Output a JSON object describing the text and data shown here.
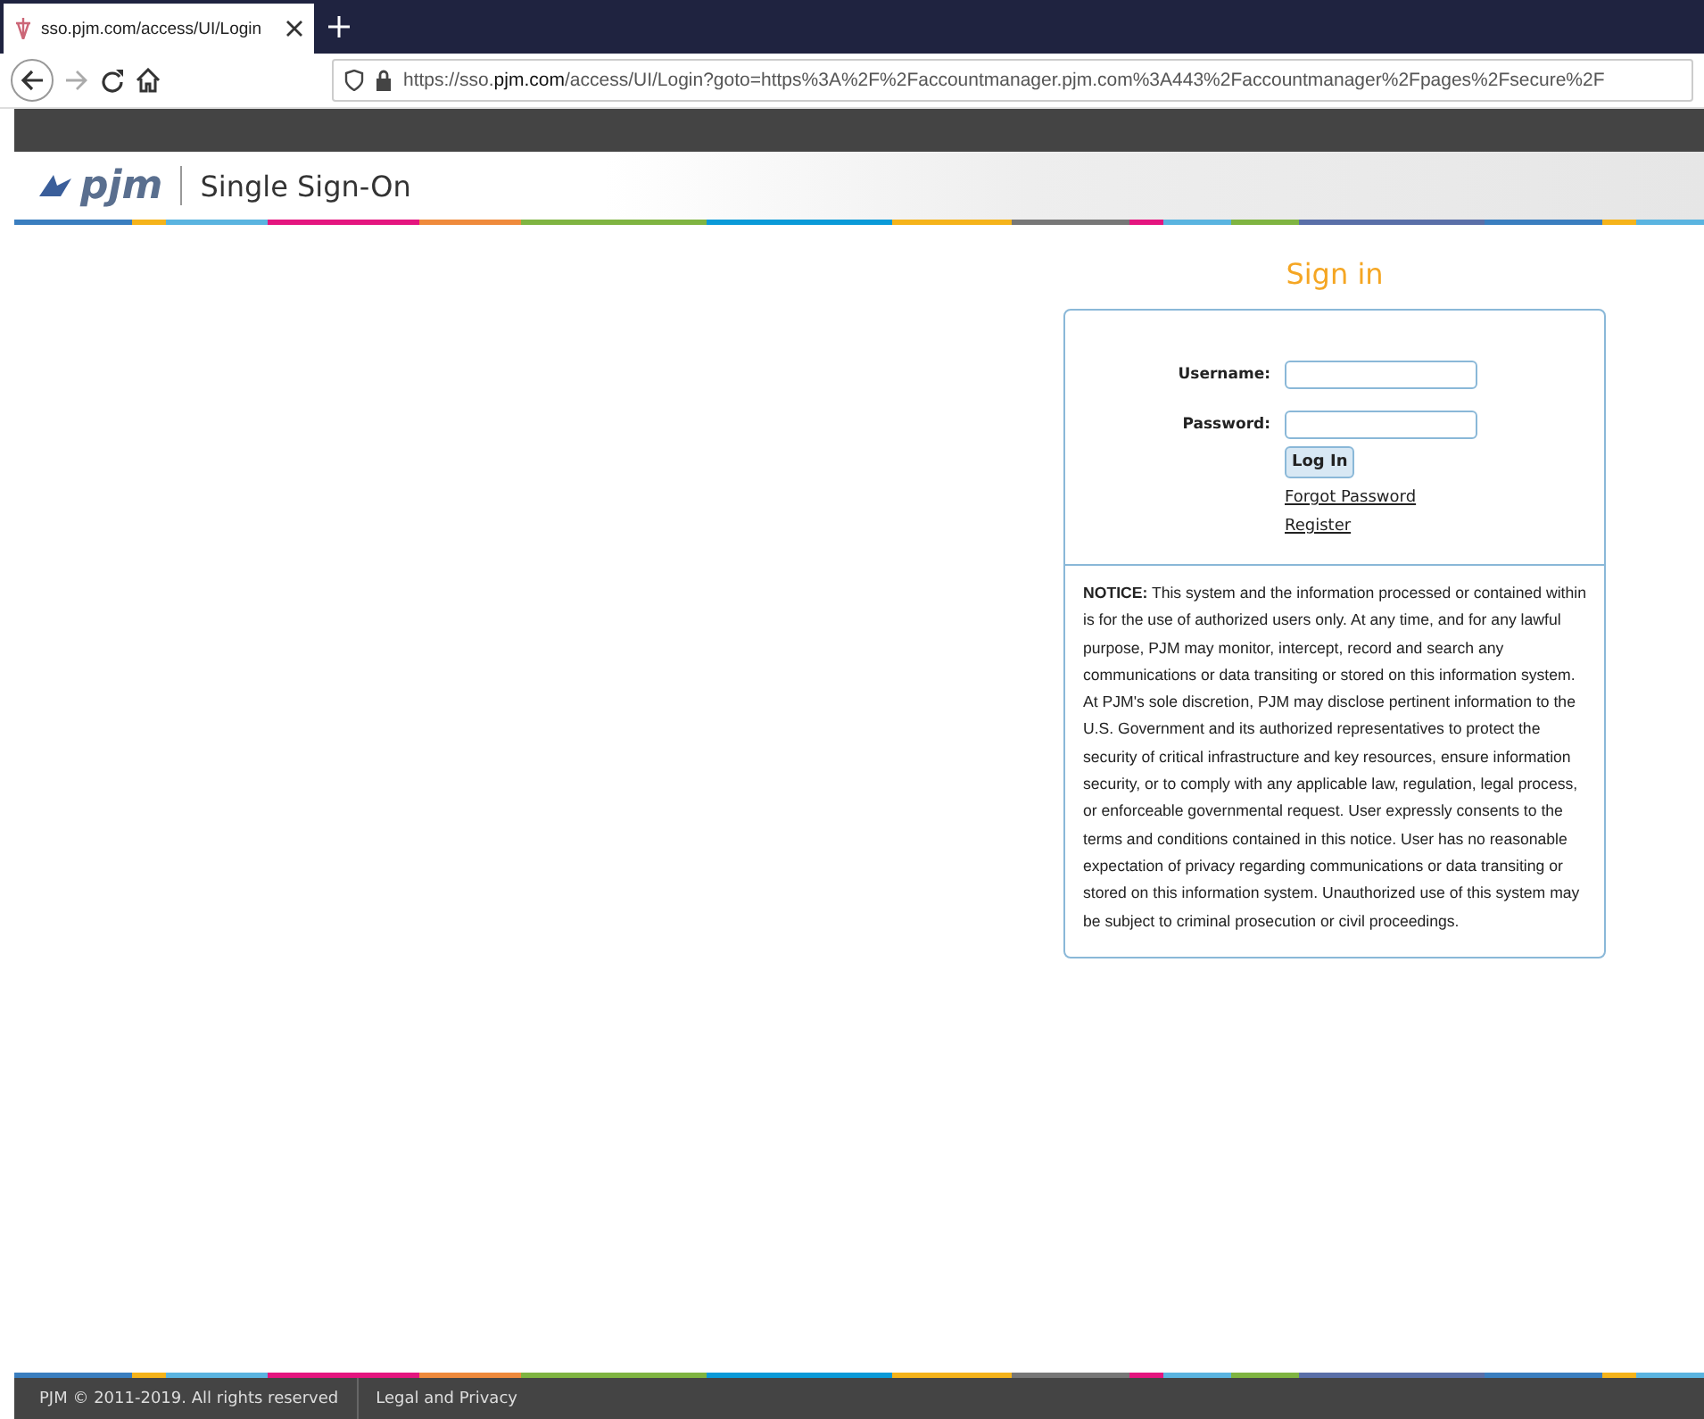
{
  "browser": {
    "tab_title": "sso.pjm.com/access/UI/Login",
    "url": "https://sso.**pjm.com**/access/UI/Login?goto=https%3A%2F%2Faccountmanager.pjm.com%3A443%2Faccountmanager%2Fpages%2Fsecure%2F"
  },
  "header": {
    "logo_text": "pjm",
    "title": "Single Sign-On"
  },
  "signin": {
    "heading": "Sign in",
    "fields": [
      {
        "label": "Username:"
      },
      {
        "label": "Password:"
      }
    ],
    "button": "Log In",
    "links": [
      "Forgot Password",
      "Register"
    ],
    "notice": "**NOTICE:** This system and the information processed or contained within is for the use of authorized users only. At any time, and for any lawful purpose, PJM may monitor, intercept, record and search any communications or data transiting or stored on this information system. At PJM's sole discretion, PJM may disclose pertinent information to the U.S. Government and its authorized representatives to protect the security of critical infrastructure and key resources, ensure information security, or to comply with any applicable law, regulation, legal process, or enforceable governmental request. User expressly consents to the terms and conditions contained in this notice. User has no reasonable expectation of privacy regarding communications or data transiting or stored on this information system. Unauthorized use of this system may be subject to criminal prosecution or civil proceedings."
  },
  "footer": {
    "copyright": "PJM © 2011-2019. All rights reserved",
    "links": [
      "Legal and Privacy"
    ]
  }
}
